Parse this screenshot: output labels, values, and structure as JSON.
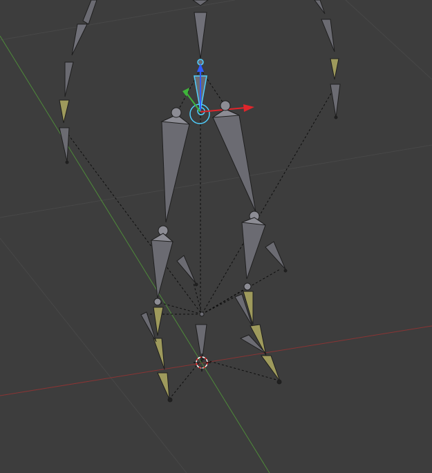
{
  "app": "3D Viewport",
  "viewport": {
    "mode": "pose",
    "background_color": "#3d3d3d",
    "grid_color": "#484848",
    "x_axis_color": "#8a3434",
    "y_axis_color": "#4e8a3a"
  },
  "armature": {
    "bone_color": "#6b6b72",
    "bone_highlight": "#8c8c94",
    "bone_selected_color": "#4fd0ff",
    "bone_constraint_color": "#9e9a5c",
    "relationship_line_color": "#000000",
    "bones": [
      "spine",
      "neck",
      "upper-arm-left",
      "forearm-left",
      "hand-left",
      "upper-arm-right",
      "forearm-right",
      "hand-right",
      "thigh-left",
      "shin-left",
      "foot-left",
      "toe-left",
      "thigh-right",
      "shin-right",
      "foot-right",
      "toe-right",
      "pelvis",
      "heel-left",
      "heel-right"
    ]
  },
  "manipulator": {
    "x_color": "#e0252b",
    "y_color": "#3fb43a",
    "z_color": "#2f5cff"
  },
  "cursor_3d": {
    "icon": "3d-cursor-icon",
    "colors": [
      "#ff2a2a",
      "#ffffff"
    ]
  }
}
